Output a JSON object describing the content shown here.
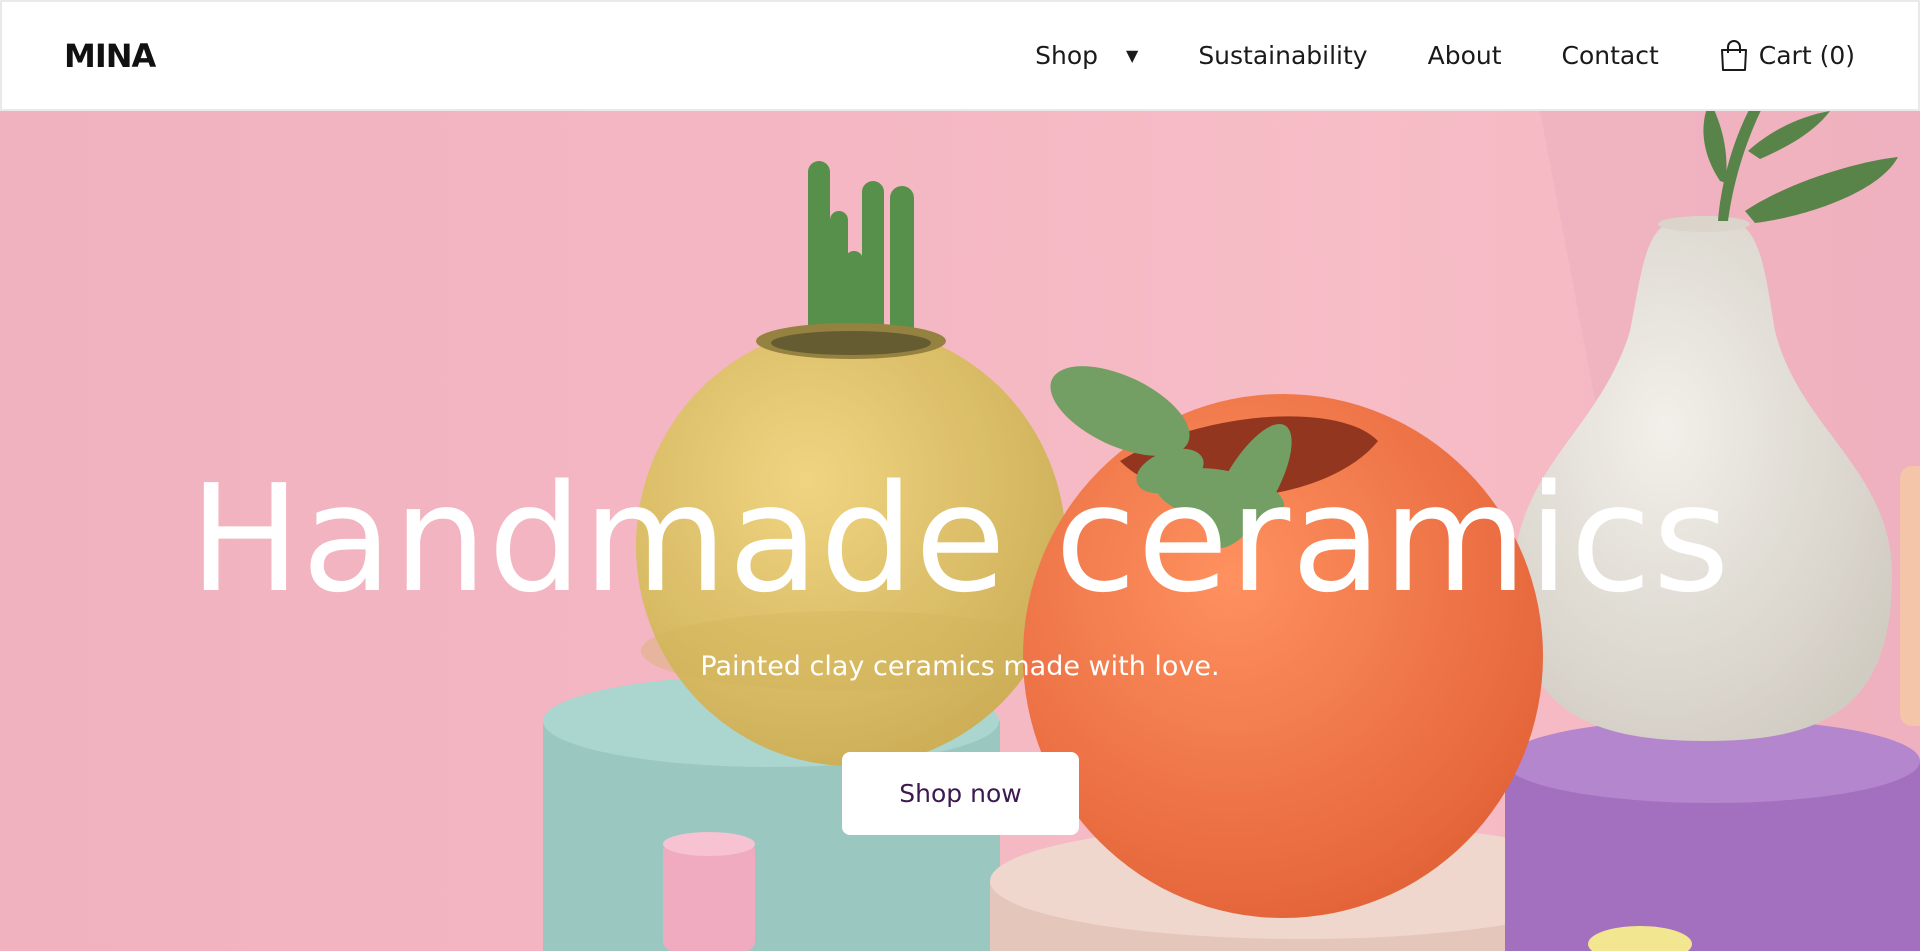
{
  "brand": {
    "logo": "MINA"
  },
  "nav": {
    "items": [
      {
        "label": "Shop",
        "has_dropdown": true
      },
      {
        "label": "Sustainability"
      },
      {
        "label": "About"
      },
      {
        "label": "Contact"
      }
    ],
    "cart_label": "Cart (0)",
    "icons": {
      "dropdown": "caret-down-icon",
      "cart": "shopping-bag-icon"
    }
  },
  "hero": {
    "title": "Handmade ceramics",
    "subtitle": "Painted clay ceramics made with love.",
    "cta_label": "Shop now"
  },
  "colors": {
    "header_bg": "#ffffff",
    "hero_bg": "#f4b3c0",
    "text_dark": "#1a1a1a",
    "cta_text": "#3c1950",
    "pot_yellow": "#e8c35f",
    "pot_orange": "#f4703e",
    "vase_white": "#e9e4dc",
    "pedestal_teal": "#9ccdc4",
    "pedestal_peach": "#e8c9bd",
    "pedestal_purple": "#a66fc0"
  }
}
